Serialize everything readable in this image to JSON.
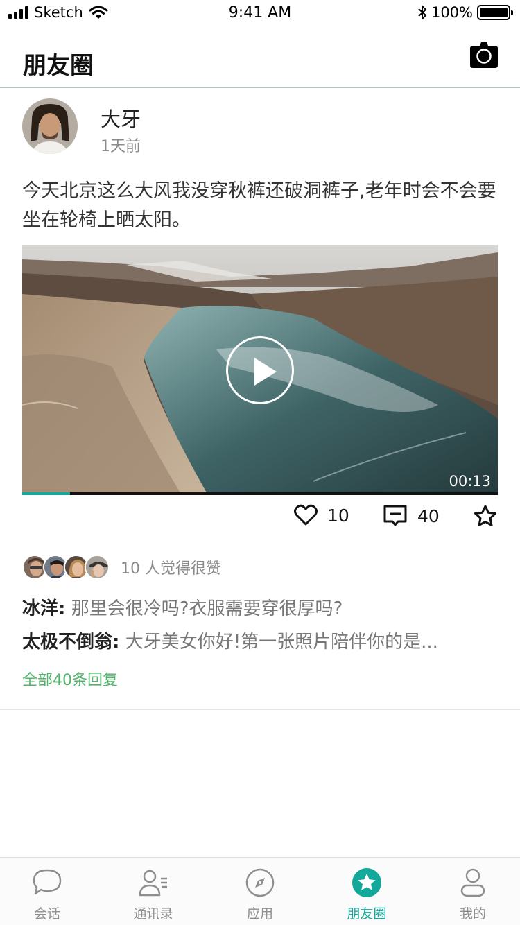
{
  "status_bar": {
    "carrier": "Sketch",
    "time": "9:41 AM",
    "battery": "100%"
  },
  "nav": {
    "title": "朋友圈"
  },
  "post": {
    "author": "大牙",
    "time_ago": "1天前",
    "text": "今天北京这么大风我没穿秋裤还破洞裤子,老年时会不会要坐在轮椅上晒太阳。",
    "video": {
      "duration": "00:13",
      "progress": 0.1
    },
    "like_count": "10",
    "comment_count": "40",
    "likes_summary": "10 人觉得很赞",
    "comments": [
      {
        "user": "冰洋",
        "text": "那里会很冷吗?衣服需要穿很厚吗?"
      },
      {
        "user": "太极不倒翁",
        "text": "大牙美女你好!第一张照片陪伴你的是..."
      }
    ],
    "all_replies": "全部40条回复"
  },
  "tabs": [
    {
      "label": "会话",
      "icon": "chat-bubble-icon",
      "active": false
    },
    {
      "label": "通讯录",
      "icon": "contacts-icon",
      "active": false
    },
    {
      "label": "应用",
      "icon": "compass-icon",
      "active": false
    },
    {
      "label": "朋友圈",
      "icon": "star-icon",
      "active": true
    },
    {
      "label": "我的",
      "icon": "person-icon",
      "active": false
    }
  ],
  "colors": {
    "accent": "#12a89a",
    "link_green": "#4fb56a",
    "muted": "#8a8a8a"
  }
}
